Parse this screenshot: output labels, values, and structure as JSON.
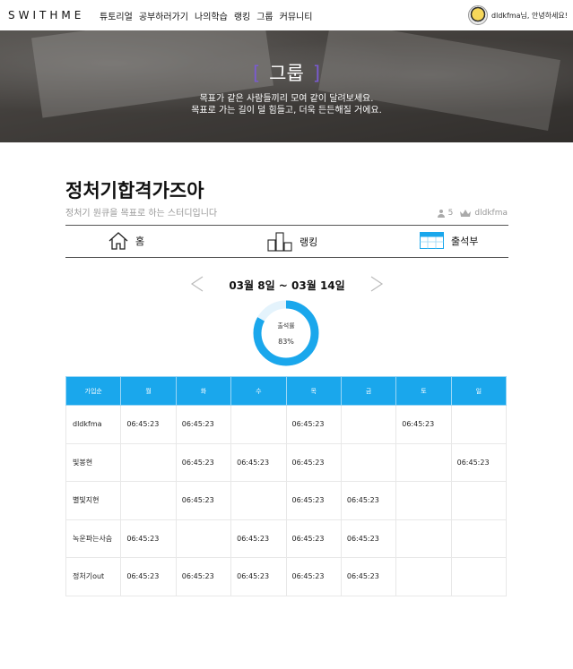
{
  "header": {
    "logo": "SWITHME",
    "nav": [
      "튜토리얼",
      "공부하러가기",
      "나의학습",
      "랭킹",
      "그룹",
      "커뮤니티"
    ],
    "user_greeting": "dldkfma님, 안녕하세요!"
  },
  "hero": {
    "bracket_left": "[",
    "title": "그룹",
    "bracket_right": "]",
    "line1": "목표가 같은 사람들끼리 모여 같이 달려보세요.",
    "line2": "목표로 가는 길이 덜 힘들고, 더욱 든든해질 거에요."
  },
  "group": {
    "name": "정처기합격가즈아",
    "description": "정처기 원큐을 목표로 하는 스터디입니다",
    "member_count": "5",
    "leader": "dldkfma"
  },
  "tabs": {
    "home": "홈",
    "ranking": "랭킹",
    "attendance": "출석부"
  },
  "week": {
    "label": "03월 8일 ~ 03월 14일"
  },
  "attendance_rate": {
    "label": "출석률",
    "value_text": "83%",
    "value": 0.83
  },
  "table": {
    "headers": [
      "가입순",
      "월",
      "화",
      "수",
      "목",
      "금",
      "토",
      "일"
    ],
    "rows": [
      [
        "dldkfma",
        "06:45:23",
        "06:45:23",
        "",
        "06:45:23",
        "",
        "06:45:23",
        ""
      ],
      [
        "빛봉현",
        "",
        "06:45:23",
        "06:45:23",
        "06:45:23",
        "",
        "",
        "06:45:23"
      ],
      [
        "별빛지현",
        "",
        "06:45:23",
        "",
        "06:45:23",
        "06:45:23",
        "",
        ""
      ],
      [
        "녹운파는사슴",
        "06:45:23",
        "",
        "06:45:23",
        "06:45:23",
        "06:45:23",
        "",
        ""
      ],
      [
        "정처기out",
        "06:45:23",
        "06:45:23",
        "06:45:23",
        "06:45:23",
        "06:45:23",
        "",
        ""
      ]
    ]
  },
  "colors": {
    "accent": "#1aa7ec",
    "bracket": "#7a5bd0"
  },
  "icons": {
    "home": "home-icon",
    "ranking": "ranking-icon",
    "attendance": "calendar-icon",
    "prev": "chevron-left-icon",
    "next": "chevron-right-icon"
  }
}
